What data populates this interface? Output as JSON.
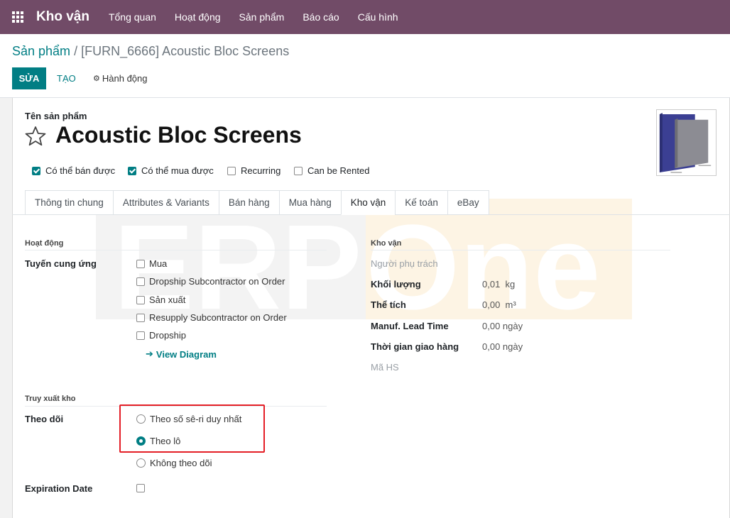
{
  "navbar": {
    "brand": "Kho vận",
    "items": [
      "Tổng quan",
      "Hoạt động",
      "Sản phẩm",
      "Báo cáo",
      "Cấu hình"
    ]
  },
  "breadcrumb": {
    "parent": "Sản phẩm",
    "separator": "/",
    "current": "[FURN_6666] Acoustic Bloc Screens"
  },
  "toolbar": {
    "edit_label": "SỬA",
    "create_label": "TẠO",
    "action_label": "Hành động"
  },
  "watermark": {
    "text_left": "ERP",
    "text_right": "One"
  },
  "product": {
    "name_label": "Tên sản phẩm",
    "name": "Acoustic Bloc Screens",
    "flags": [
      {
        "label": "Có thể bán được",
        "checked": true
      },
      {
        "label": "Có thể mua được",
        "checked": true
      },
      {
        "label": "Recurring",
        "checked": false
      },
      {
        "label": "Can be Rented",
        "checked": false
      }
    ]
  },
  "tabs": [
    {
      "label": "Thông tin chung",
      "active": false
    },
    {
      "label": "Attributes & Variants",
      "active": false
    },
    {
      "label": "Bán hàng",
      "active": false
    },
    {
      "label": "Mua hàng",
      "active": false
    },
    {
      "label": "Kho vận",
      "active": true
    },
    {
      "label": "Kế toán",
      "active": false
    },
    {
      "label": "eBay",
      "active": false
    }
  ],
  "operations": {
    "section_title": "Hoạt động",
    "routes_label": "Tuyến cung ứng",
    "routes": [
      {
        "label": "Mua",
        "checked": false
      },
      {
        "label": "Dropship Subcontractor on Order",
        "checked": false
      },
      {
        "label": "Sản xuất",
        "checked": false
      },
      {
        "label": "Resupply Subcontractor on Order",
        "checked": false
      },
      {
        "label": "Dropship",
        "checked": false
      }
    ],
    "view_diagram": "View Diagram"
  },
  "logistics": {
    "section_title": "Kho vận",
    "responsible_label": "Người phụ trách",
    "weight_label": "Khối lượng",
    "weight_value": "0,01",
    "weight_unit": "kg",
    "volume_label": "Thể tích",
    "volume_value": "0,00",
    "volume_unit": "m³",
    "lead_time_label": "Manuf. Lead Time",
    "lead_time_value": "0,00 ngày",
    "delivery_label": "Thời gian giao hàng",
    "delivery_value": "0,00 ngày",
    "hs_label": "Mã HS"
  },
  "traceability": {
    "section_title": "Truy xuất kho",
    "tracking_label": "Theo dõi",
    "options": [
      {
        "label": "Theo số sê-ri duy nhất",
        "selected": false
      },
      {
        "label": "Theo lô",
        "selected": true
      },
      {
        "label": "Không theo dõi",
        "selected": false
      }
    ],
    "expiration_label": "Expiration Date",
    "expiration_checked": false
  },
  "colors": {
    "navbar": "#714b67",
    "primary": "#017e84",
    "highlight": "#e41e26"
  }
}
